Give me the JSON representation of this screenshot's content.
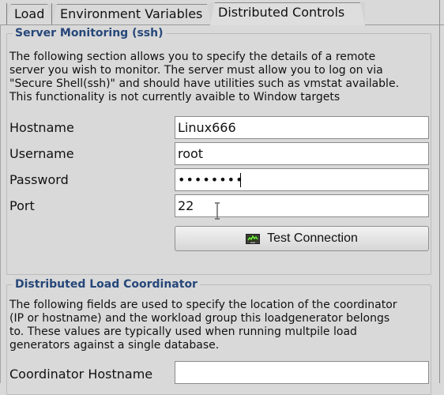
{
  "tabs": [
    {
      "label": "Load",
      "selected": false
    },
    {
      "label": "Environment Variables",
      "selected": false
    },
    {
      "label": "Distributed Controls",
      "selected": true
    }
  ],
  "server_monitoring": {
    "title": "Server Monitoring (ssh)",
    "description": "The following section allows you to specify the details of a remote\nserver you wish to monitor. The server must allow you to log on via\n\"Secure Shell(ssh)\" and should have utilities such as vmstat available.\nThis functionality is not currently avaible to Window targets",
    "fields": {
      "hostname": {
        "label": "Hostname",
        "value": "Linux666"
      },
      "username": {
        "label": "Username",
        "value": "root"
      },
      "password": {
        "label": "Password",
        "value": "••••••••"
      },
      "port": {
        "label": "Port",
        "value": "22"
      }
    },
    "test_button": {
      "label": "Test Connection",
      "icon": "monitor-icon"
    }
  },
  "distributed_coordinator": {
    "title": "Distributed Load Coordinator",
    "description": "The following fields are used to specify the location of the coordinator\n(IP or hostname) and the workload group this loadgenerator belongs\nto. These values are typically used when running multpile load\ngenerators against a single database.",
    "fields": {
      "coordinator_hostname": {
        "label": "Coordinator Hostname",
        "value": ""
      }
    }
  },
  "colors": {
    "background": "#d9d9d9",
    "group_title": "#264779",
    "field_background": "#ffffff",
    "border": "#8b8b8b"
  }
}
